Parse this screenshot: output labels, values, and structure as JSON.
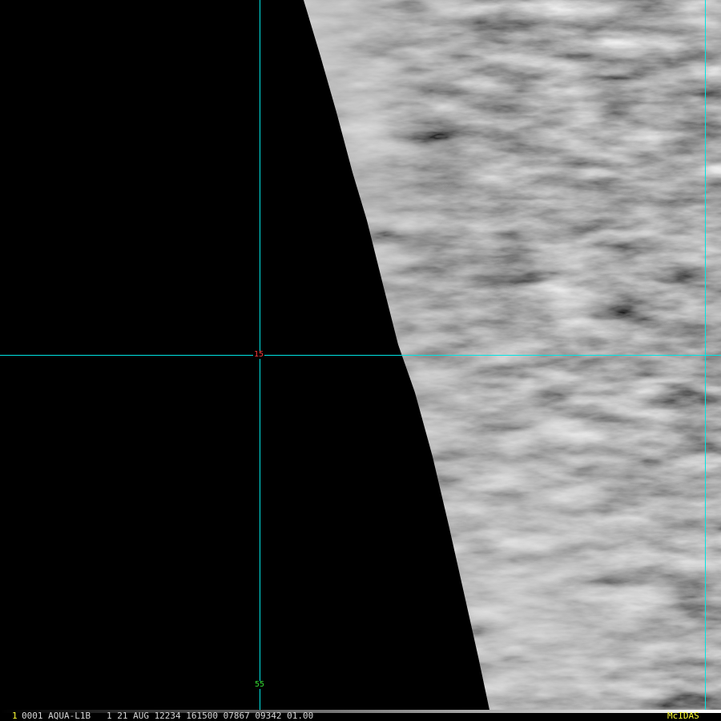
{
  "colors": {
    "gridline": "#00e5e5",
    "lat_label": "#ff3b3b",
    "lon_label": "#33dd33",
    "frame_number": "#ffff33",
    "status_text": "#d8d8d8",
    "system_name": "#ffff33",
    "background": "#000000"
  },
  "map": {
    "latitude_label": "15",
    "longitude_label": "55"
  },
  "status_bar": {
    "frame_number": "1",
    "image_info": "0001 AQUA-L1B   1 21 AUG 12234 161500 07867 09342 01.00",
    "system_name": "McIDAS"
  }
}
